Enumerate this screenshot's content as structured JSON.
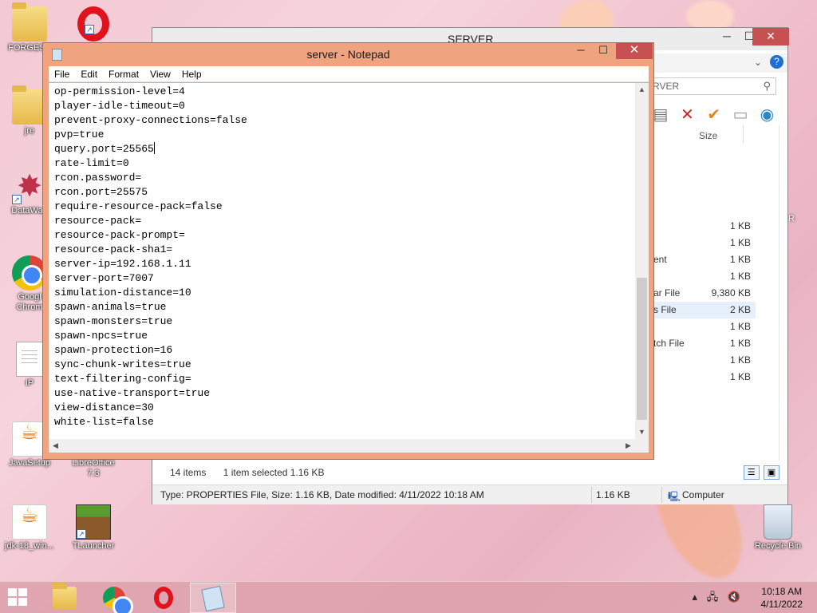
{
  "desktop_icons": [
    {
      "label": "FORGESE",
      "icon": "folder-icon"
    },
    {
      "label": "",
      "icon": "opera-icon"
    },
    {
      "label": "jre",
      "icon": "folder-icon"
    },
    {
      "label": "DataWag",
      "icon": "datawag-icon"
    },
    {
      "label": "Googl Chrom",
      "icon": "chrome-icon"
    },
    {
      "label": "IP",
      "icon": "text-file-icon"
    },
    {
      "label": "JavaSetup",
      "icon": "java-icon"
    },
    {
      "label": "LibreOffice 7.3",
      "icon": "libreoffice-icon"
    },
    {
      "label": "jdk-18_win...",
      "icon": "java-installer-icon"
    },
    {
      "label": "TLauncher",
      "icon": "minecraft-icon"
    },
    {
      "label": "Recycle Bin",
      "icon": "recycle-bin-icon"
    }
  ],
  "explorer": {
    "title": "SERVER",
    "search_placeholder": "RVER",
    "size_header": "Size",
    "rows": [
      {
        "type": "",
        "size": "1 KB"
      },
      {
        "type": "",
        "size": "1 KB"
      },
      {
        "type": "ent",
        "size": "1 KB"
      },
      {
        "type": "",
        "size": "1 KB"
      },
      {
        "type": "ar File",
        "size": "9,380 KB"
      },
      {
        "type": "s File",
        "size": "2 KB",
        "selected": true
      },
      {
        "type": "",
        "size": "1 KB"
      },
      {
        "type": "tch File",
        "size": "1 KB"
      },
      {
        "type": "",
        "size": "1 KB"
      },
      {
        "type": "",
        "size": "1 KB"
      }
    ],
    "item_count": "14 items",
    "selection": "1 item selected  1.16 KB",
    "details": "Type: PROPERTIES File, Size: 1.16 KB, Date modified: 4/11/2022 10:18 AM",
    "details_size": "1.16 KB",
    "location": "Computer",
    "right_edge_letter": "R"
  },
  "notepad": {
    "title": "server - Notepad",
    "menu": [
      "File",
      "Edit",
      "Format",
      "View",
      "Help"
    ],
    "lines": [
      "op-permission-level=4",
      "player-idle-timeout=0",
      "prevent-proxy-connections=false",
      "pvp=true",
      "query.port=25565",
      "rate-limit=0",
      "rcon.password=",
      "rcon.port=25575",
      "require-resource-pack=false",
      "resource-pack=",
      "resource-pack-prompt=",
      "resource-pack-sha1=",
      "server-ip=192.168.1.11",
      "server-port=7007",
      "simulation-distance=10",
      "spawn-animals=true",
      "spawn-monsters=true",
      "spawn-npcs=true",
      "spawn-protection=16",
      "sync-chunk-writes=true",
      "text-filtering-config=",
      "use-native-transport=true",
      "view-distance=30",
      "white-list=false"
    ],
    "caret_line": 4
  },
  "taskbar": {
    "items": [
      {
        "name": "file-explorer",
        "icon": "file-explorer-icon"
      },
      {
        "name": "chrome",
        "icon": "chrome-icon"
      },
      {
        "name": "opera",
        "icon": "opera-icon"
      },
      {
        "name": "notepad",
        "icon": "notepad-icon",
        "active": true
      }
    ],
    "time": "10:18 AM",
    "date": "4/11/2022"
  },
  "colors": {
    "notepad_frame": "#f0a37f",
    "close_button": "#c75050",
    "taskbar": "#dca0aa"
  }
}
